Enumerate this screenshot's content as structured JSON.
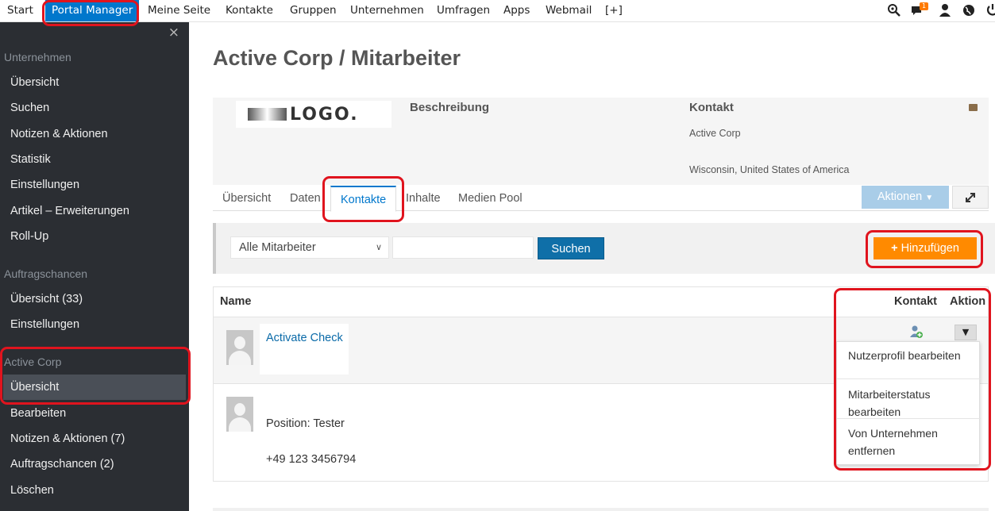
{
  "topnav": {
    "items": [
      "Start",
      "Portal Manager",
      "Meine Seite",
      "Kontakte",
      "Gruppen",
      "Unternehmen",
      "Umfragen",
      "Apps",
      "Webmail",
      "[+]"
    ],
    "notification_count": "1",
    "icons": [
      "search-icon",
      "chat-icon",
      "user-icon",
      "globe-icon",
      "power-icon"
    ]
  },
  "sidebar": {
    "close_glyph": "×",
    "groups": [
      {
        "title": "Unternehmen",
        "items": [
          "Übersicht",
          "Suchen",
          "Notizen & Aktionen",
          "Statistik",
          "Einstellungen",
          "Artikel – Erweiterungen",
          "Roll-Up"
        ]
      },
      {
        "title": "Auftragschancen",
        "items": [
          "Übersicht (33)",
          "Einstellungen"
        ]
      },
      {
        "title": "Active Corp",
        "items": [
          "Übersicht",
          "Bearbeiten",
          "Notizen & Aktionen (7)",
          "Auftragschancen (2)",
          "Löschen"
        ]
      }
    ]
  },
  "page": {
    "title": "Active Corp / Mitarbeiter"
  },
  "profile": {
    "logo_text": "LOGO.",
    "description_label": "Beschreibung",
    "contact_label": "Kontakt",
    "company": "Active Corp",
    "location": "Wisconsin, United States of America"
  },
  "tabs": [
    "Übersicht",
    "Daten",
    "Kontakte",
    "Inhalte",
    "Medien Pool"
  ],
  "tab_active": "Kontakte",
  "toolbar": {
    "actions_label": "Aktionen",
    "expand_icon": "expand-icon"
  },
  "filter": {
    "select_value": "Alle Mitarbeiter",
    "search_label": "Suchen",
    "add_label": "Hinzufügen",
    "add_plus": "+"
  },
  "table": {
    "columns": [
      "Name",
      "Kontakt",
      "Aktion"
    ],
    "rows": [
      {
        "name": "Activate Check"
      },
      {
        "position": "Position: Tester",
        "phone": "+49 123 3456794"
      }
    ]
  },
  "dropdown": {
    "items": [
      "Nutzerprofil bearbeiten",
      "Mitarbeiterstatus bearbeiten",
      "Von Unternehmen entfernen"
    ]
  },
  "colors": {
    "accent": "#0077cc",
    "add_button": "#ff8a00",
    "search_button": "#0f6fa8",
    "sidebar_bg": "#2b2e33",
    "annotation": "#e0141e"
  }
}
